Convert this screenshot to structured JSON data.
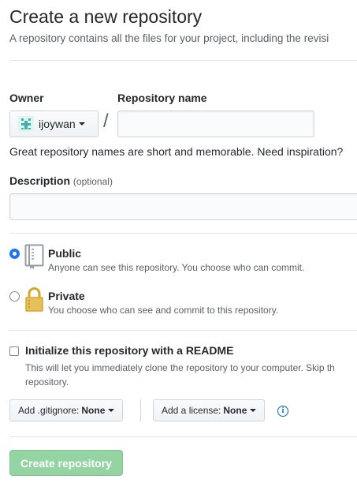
{
  "header": {
    "title": "Create a new repository",
    "subtitle": "A repository contains all the files for your project, including the revisi"
  },
  "owner": {
    "label": "Owner",
    "value": "ijoywan",
    "avatar_icon": "identicon"
  },
  "repo_name": {
    "label": "Repository name",
    "separator": "/",
    "value": "",
    "hint": "Great repository names are short and memorable. Need inspiration?"
  },
  "description": {
    "label": "Description",
    "optional": "(optional)",
    "value": ""
  },
  "visibility": {
    "selected": "public",
    "options": [
      {
        "id": "public",
        "title": "Public",
        "desc": "Anyone can see this repository. You choose who can commit.",
        "icon": "repo-book-icon"
      },
      {
        "id": "private",
        "title": "Private",
        "desc": "You choose who can see and commit to this repository.",
        "icon": "lock-icon"
      }
    ]
  },
  "readme": {
    "checked": false,
    "title": "Initialize this repository with a README",
    "desc": "This will let you immediately clone the repository to your computer. Skip th repository."
  },
  "gitignore": {
    "label": "Add .gitignore:",
    "value": "None"
  },
  "license": {
    "label": "Add a license:",
    "value": "None"
  },
  "submit": {
    "label": "Create repository",
    "color": "#94d3a2"
  }
}
